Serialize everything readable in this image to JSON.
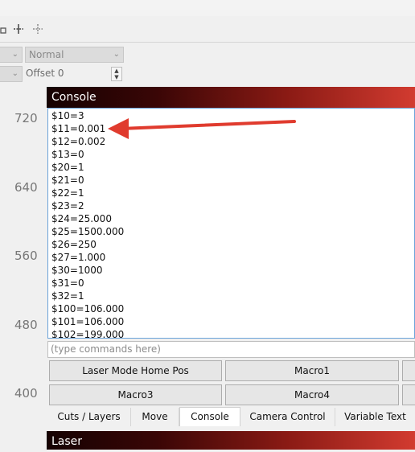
{
  "toolbar": {
    "icons": [
      "align-icon",
      "move-icon",
      "grid-icon"
    ]
  },
  "layer_controls": {
    "combo_left_value": "",
    "mode_combo_value": "Normal",
    "offset_label": "Offset",
    "offset_value": "0"
  },
  "ruler": {
    "ticks": [
      "720",
      "640",
      "560",
      "480",
      "400"
    ]
  },
  "console": {
    "title": "Console",
    "lines": [
      "$10=3",
      "$11=0.001",
      "$12=0.002",
      "$13=0",
      "$20=1",
      "$21=0",
      "$22=1",
      "$23=2",
      "$24=25.000",
      "$25=1500.000",
      "$26=250",
      "$27=1.000",
      "$30=1000",
      "$31=0",
      "$32=1",
      "$100=106.000",
      "$101=106.000",
      "$102=199.000"
    ],
    "input_placeholder": "(type commands here)"
  },
  "macro_buttons": {
    "laser_mode_home": "Laser Mode Home Pos",
    "macro1": "Macro1",
    "macro3": "Macro3",
    "macro4": "Macro4"
  },
  "tabs": [
    "Cuts / Layers",
    "Move",
    "Console",
    "Camera Control",
    "Variable Text"
  ],
  "active_tab": "Console",
  "laser_panel": {
    "title": "Laser"
  },
  "colors": {
    "arrow": "#e03b2e",
    "header_start": "#150202",
    "header_end": "#d23b30",
    "console_border": "#6aa3d9"
  }
}
